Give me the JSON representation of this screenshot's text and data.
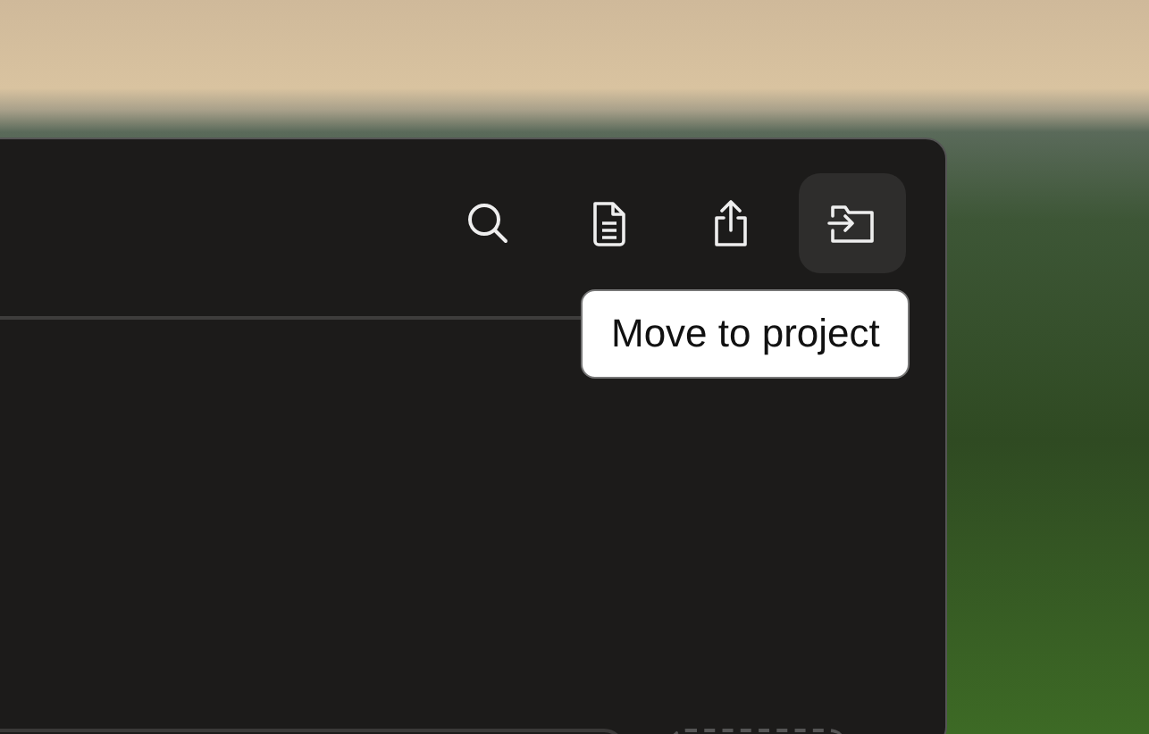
{
  "toolbar": {
    "buttons": [
      {
        "kind": "search",
        "hovered": false
      },
      {
        "kind": "document",
        "hovered": false
      },
      {
        "kind": "share",
        "hovered": false
      },
      {
        "kind": "move",
        "hovered": true
      }
    ]
  },
  "tooltip": {
    "text": "Move to project"
  }
}
